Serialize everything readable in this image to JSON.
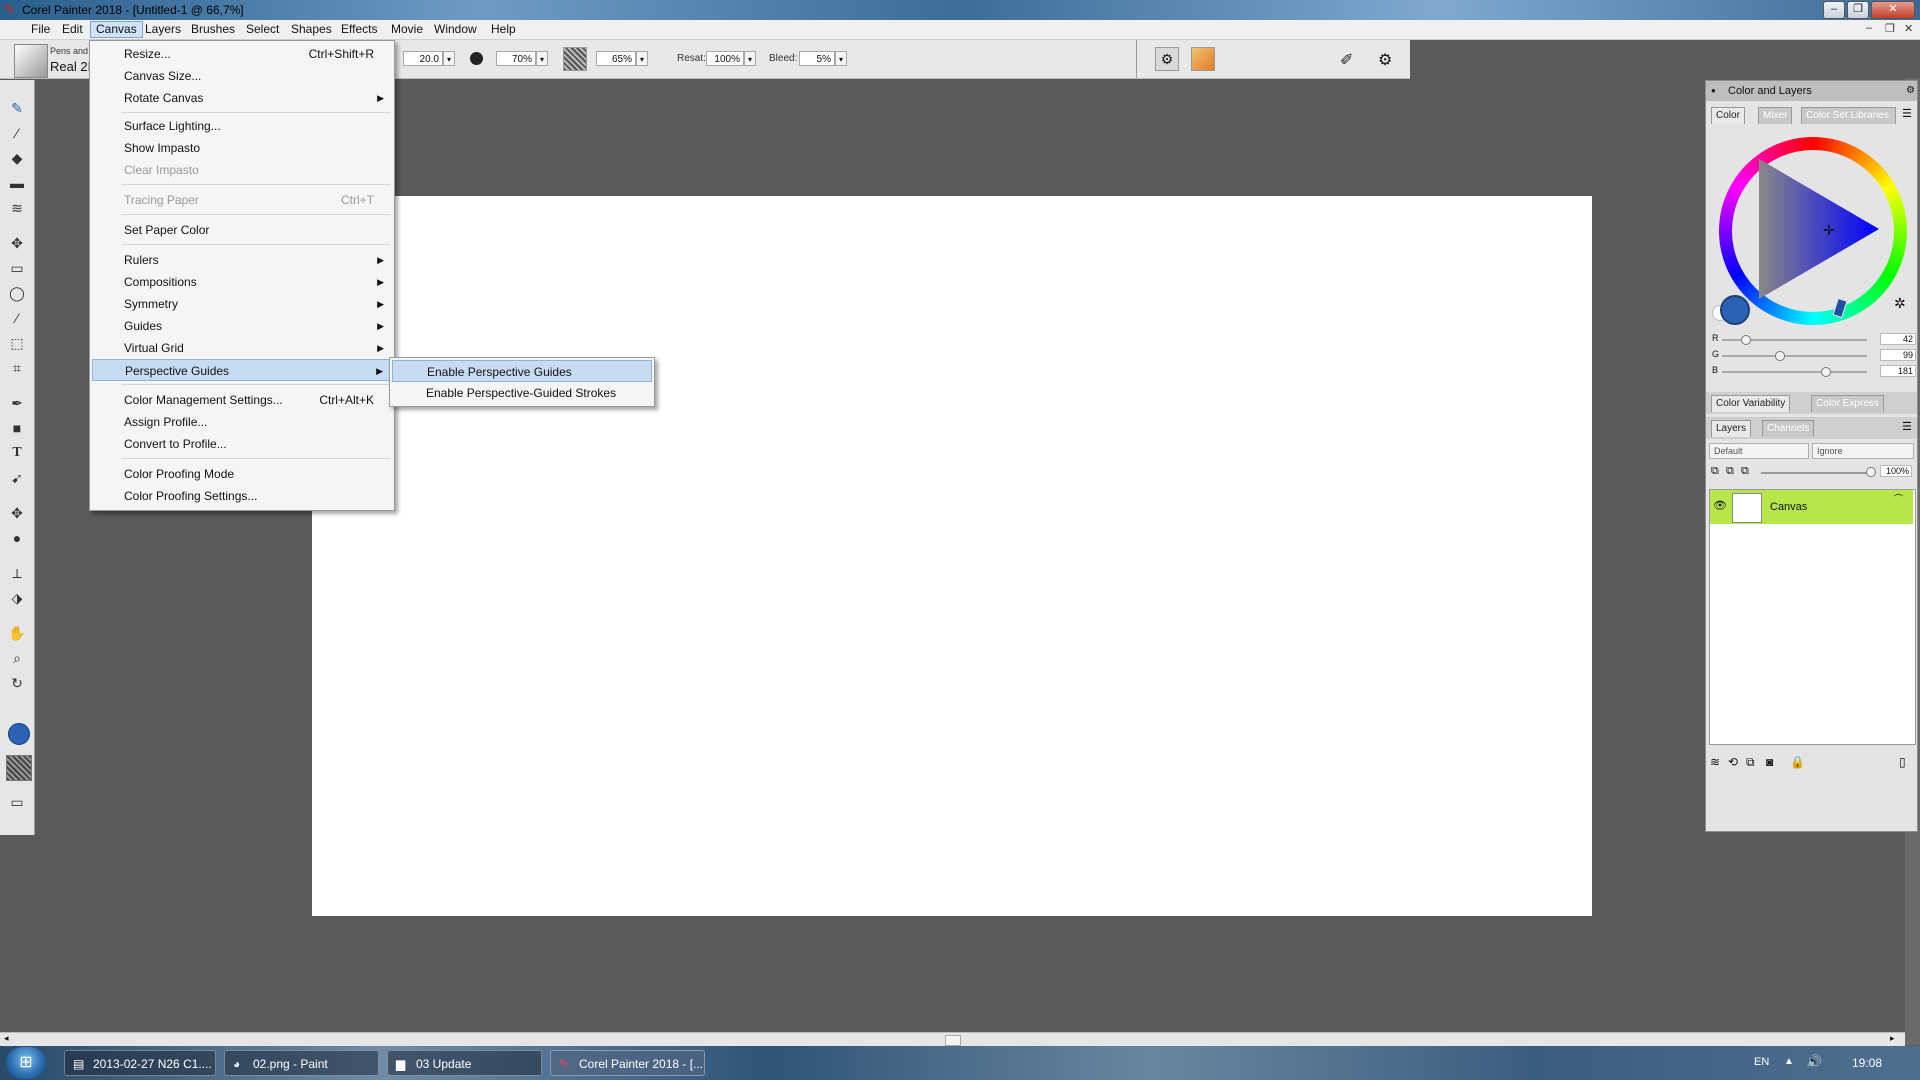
{
  "window": {
    "title": "Corel Painter 2018 - [Untitled-1 @ 66,7%]"
  },
  "menubar": [
    "File",
    "Edit",
    "Canvas",
    "Layers",
    "Brushes",
    "Select",
    "Shapes",
    "Effects",
    "Movie",
    "Window",
    "Help"
  ],
  "propbar": {
    "brush_category": "Pens and",
    "brush_variant": "Real 2B",
    "size": "20.0",
    "opacity": "70%",
    "grain": "65%",
    "resat_label": "Resat:",
    "resat": "100%",
    "bleed_label": "Bleed:",
    "bleed": "5%"
  },
  "canvas_menu": {
    "items": [
      {
        "label": "Resize...",
        "shortcut": "Ctrl+Shift+R"
      },
      {
        "label": "Canvas Size..."
      },
      {
        "label": "Rotate Canvas",
        "submenu": true
      },
      {
        "label": "Surface Lighting..."
      },
      {
        "label": "Show Impasto"
      },
      {
        "label": "Clear Impasto",
        "disabled": true
      },
      {
        "label": "Tracing Paper",
        "shortcut": "Ctrl+T",
        "disabled": true
      },
      {
        "label": "Set Paper Color"
      },
      {
        "label": "Rulers",
        "submenu": true
      },
      {
        "label": "Compositions",
        "submenu": true
      },
      {
        "label": "Symmetry",
        "submenu": true
      },
      {
        "label": "Guides",
        "submenu": true
      },
      {
        "label": "Virtual Grid",
        "submenu": true
      },
      {
        "label": "Perspective Guides",
        "submenu": true,
        "highlighted": true
      },
      {
        "label": "Color Management Settings...",
        "shortcut": "Ctrl+Alt+K"
      },
      {
        "label": "Assign Profile..."
      },
      {
        "label": "Convert to Profile..."
      },
      {
        "label": "Color Proofing Mode"
      },
      {
        "label": "Color Proofing Settings..."
      }
    ]
  },
  "perspective_submenu": {
    "items": [
      {
        "label": "Enable Perspective Guides",
        "highlighted": true
      },
      {
        "label": "Enable Perspective-Guided Strokes"
      }
    ]
  },
  "panel": {
    "title": "Color and Layers",
    "color_tabs": [
      "Color",
      "Mixer",
      "Color Set Libraries"
    ],
    "rgb": {
      "R": "42",
      "G": "99",
      "B": "181"
    },
    "rgb_fractions": {
      "R": 0.16,
      "G": 0.39,
      "B": 0.71
    },
    "current_color": "#2a63b5",
    "variability_tabs": [
      "Color Variability",
      "Color Express"
    ],
    "layer_tabs": [
      "Layers",
      "Channels"
    ],
    "composite_method": "Default",
    "preserve": "Ignore",
    "layer_opacity": "100%",
    "layers": [
      {
        "name": "Canvas",
        "selected_color": "#b7e64a"
      }
    ]
  },
  "taskbar": {
    "tasks": [
      "2013-02-27 N26 C1....",
      "02.png - Paint",
      "03 Update",
      "Corel Painter 2018 - [..."
    ],
    "language": "EN",
    "clock": "19:08"
  }
}
